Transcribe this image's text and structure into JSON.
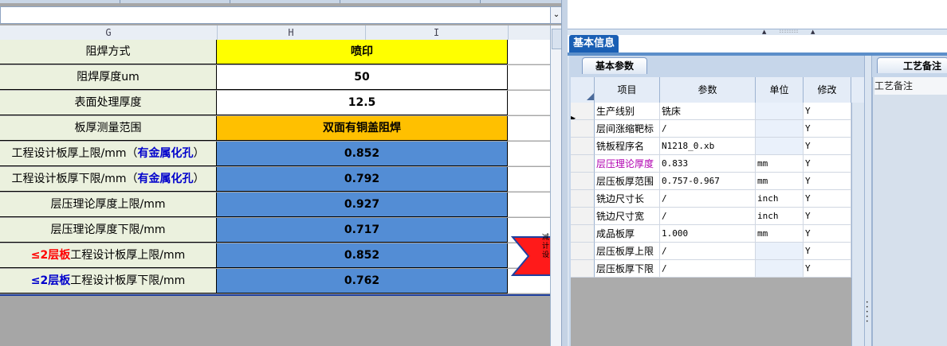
{
  "sheet": {
    "columns": [
      "G",
      "H",
      "I"
    ],
    "rows": [
      {
        "label": "阻焊方式",
        "value": "喷印",
        "fill": "yellow"
      },
      {
        "label": "阻焊厚度um",
        "value": "50",
        "fill": "white"
      },
      {
        "label": "表面处理厚度",
        "value": "12.5",
        "fill": "white"
      },
      {
        "label": "板厚测量范围",
        "value": "双面有铜盖阻焊",
        "fill": "orange"
      },
      {
        "label_pre": "工程设计板厚上限/mm（",
        "label_em": "有金属化孔",
        "label_post": "）",
        "value": "0.852",
        "fill": "blue"
      },
      {
        "label_pre": "工程设计板厚下限/mm（",
        "label_em": "有金属化孔",
        "label_post": "）",
        "value": "0.792",
        "fill": "blue"
      },
      {
        "label": "层压理论厚度上限/mm",
        "value": "0.927",
        "fill": "blue"
      },
      {
        "label": "层压理论厚度下限/mm",
        "value": "0.717",
        "fill": "blue"
      },
      {
        "label_em": "≤2层板",
        "label_post": "工程设计板厚上限/mm",
        "value": "0.852",
        "fill": "blue"
      },
      {
        "label_em": "≤2层板",
        "label_post": "工程设计板厚下限/mm",
        "value": "0.762",
        "fill": "blue"
      }
    ],
    "arrow_text": "减计设"
  },
  "panel": {
    "tab_basic_info": "基本信息",
    "tab_basic_params": "基本参数",
    "tab_process_notes": "工艺备注",
    "notes_label": "工艺备注",
    "headers": {
      "item": "项目",
      "param": "参数",
      "unit": "单位",
      "modify": "修改"
    },
    "params": [
      {
        "item": "生产线别",
        "param": "铣床",
        "unit": "",
        "modify": "Y"
      },
      {
        "item": "层间涨缩靶标",
        "param": "/",
        "unit": "",
        "modify": "Y"
      },
      {
        "item": "铣板程序名",
        "param": "N1218_0.xb",
        "unit": "",
        "modify": "Y"
      },
      {
        "item": "层压理论厚度",
        "param": "0.833",
        "unit": "mm",
        "modify": "Y"
      },
      {
        "item": "层压板厚范围",
        "param": "0.757-0.967",
        "unit": "mm",
        "modify": "Y"
      },
      {
        "item": "铣边尺寸长",
        "param": "/",
        "unit": "inch",
        "modify": "Y"
      },
      {
        "item": "铣边尺寸宽",
        "param": "/",
        "unit": "inch",
        "modify": "Y"
      },
      {
        "item": "成品板厚",
        "param": "1.000",
        "unit": "mm",
        "modify": "Y"
      },
      {
        "item": "层压板厚上限",
        "param": "/",
        "unit": "",
        "modify": "Y"
      },
      {
        "item": "层压板厚下限",
        "param": "/",
        "unit": "",
        "modify": "Y"
      }
    ]
  },
  "colors": {
    "yellow": "#ffff00",
    "orange": "#ffc000",
    "blue": "#538dd5",
    "label_green": "#ebf1de",
    "tab_blue": "#1a5fb4",
    "highlight_pink": "#b000b0",
    "emphasis_red": "#ff0000",
    "emphasis_navy": "#0000cc"
  }
}
